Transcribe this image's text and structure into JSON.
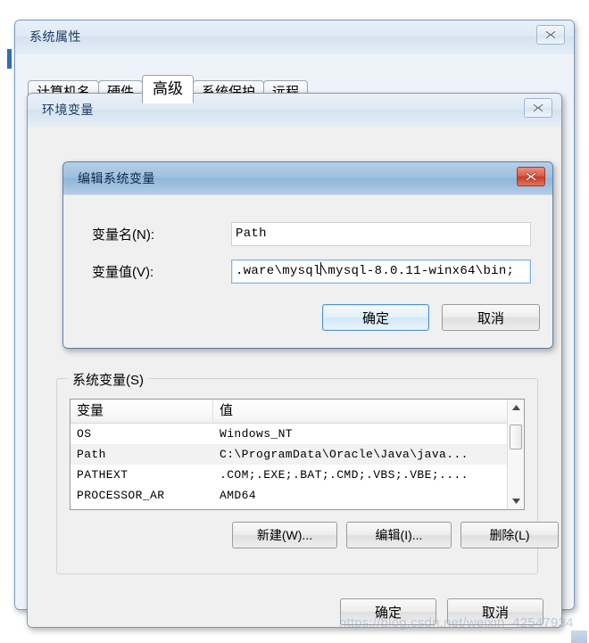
{
  "system_properties": {
    "title": "系统属性",
    "close_icon": "close-icon",
    "tabs": [
      {
        "label": "计算机名",
        "selected": false
      },
      {
        "label": "硬件",
        "selected": false
      },
      {
        "label": "高级",
        "selected": true
      },
      {
        "label": "系统保护",
        "selected": false
      },
      {
        "label": "远程",
        "selected": false
      }
    ]
  },
  "environment_variables": {
    "title": "环境变量",
    "close_icon": "close-icon",
    "system_group": {
      "label": "系统变量(S)",
      "columns": [
        "变量",
        "值"
      ],
      "rows": [
        {
          "name": "OS",
          "value": "Windows_NT",
          "selected": false
        },
        {
          "name": "Path",
          "value": "C:\\ProgramData\\Oracle\\Java\\java...",
          "selected": true
        },
        {
          "name": "PATHEXT",
          "value": ".COM;.EXE;.BAT;.CMD;.VBS;.VBE;....",
          "selected": false
        },
        {
          "name": "PROCESSOR_AR",
          "value": "AMD64",
          "selected": false
        }
      ],
      "buttons": {
        "new": "新建(W)...",
        "edit": "编辑(I)...",
        "delete": "删除(L)"
      }
    },
    "footer": {
      "ok": "确定",
      "cancel": "取消"
    }
  },
  "edit_system_variable": {
    "title": "编辑系统变量",
    "close_icon": "close-icon",
    "fields": {
      "name_label": "变量名(N):",
      "name_value": "Path",
      "value_label": "变量值(V):",
      "value_before_caret": ".ware\\mysql",
      "value_after_caret": "\\mysql-8.0.11-winx64\\bin;"
    },
    "buttons": {
      "ok": "确定",
      "cancel": "取消"
    }
  },
  "watermark": {
    "text": "https://blog.csdn.net/weixin_42547934"
  },
  "colors": {
    "active_title": "#9ec0df",
    "inactive_title": "#dfe9f4",
    "close_red": "#c63c22",
    "selection_row": "#f2f2f2",
    "focus_border": "#7eb4ea"
  }
}
